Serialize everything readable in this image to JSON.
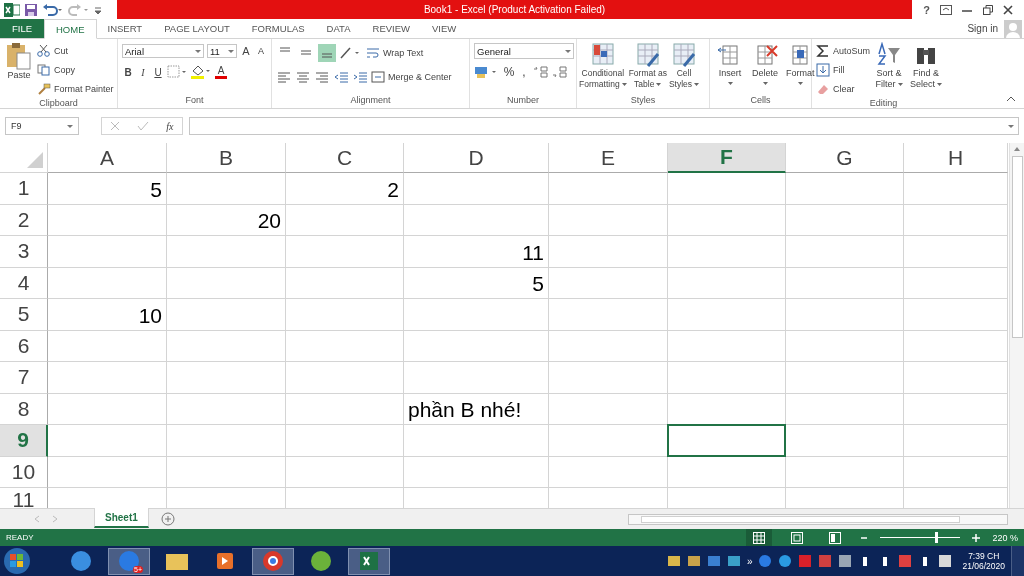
{
  "window": {
    "title": "Book1 -  Excel (Product Activation Failed)",
    "help": "?"
  },
  "tabs": [
    {
      "label": "FILE",
      "kind": "file",
      "selected": false
    },
    {
      "label": "HOME",
      "kind": "tab",
      "selected": true
    },
    {
      "label": "INSERT",
      "kind": "tab",
      "selected": false
    },
    {
      "label": "PAGE LAYOUT",
      "kind": "tab",
      "selected": false
    },
    {
      "label": "FORMULAS",
      "kind": "tab",
      "selected": false
    },
    {
      "label": "DATA",
      "kind": "tab",
      "selected": false
    },
    {
      "label": "REVIEW",
      "kind": "tab",
      "selected": false
    },
    {
      "label": "VIEW",
      "kind": "tab",
      "selected": false
    }
  ],
  "account": {
    "label": "Sign in"
  },
  "ribbon": {
    "groups": [
      {
        "label": "Clipboard",
        "kind": "clipboard",
        "paste": "Paste",
        "items": [
          "Cut",
          "Copy",
          "Format Painter"
        ]
      },
      {
        "label": "Font",
        "kind": "font",
        "font": "Arial",
        "size": "11",
        "size_buttons": [
          "A",
          "A"
        ],
        "styles": [
          "B",
          "I",
          "U"
        ],
        "font_color": "A"
      },
      {
        "label": "Alignment",
        "kind": "alignment",
        "vertical_align": [
          {
            "selected": false
          },
          {
            "selected": false
          },
          {
            "selected": true
          }
        ],
        "items": [
          "Wrap Text",
          "Merge & Center"
        ]
      },
      {
        "label": "Number",
        "kind": "number",
        "format": "General",
        "symbols": [
          "%",
          ","
        ]
      },
      {
        "label": "Styles",
        "kind": "styles",
        "items": [
          {
            "lines": [
              "Conditional",
              "Formatting"
            ]
          },
          {
            "lines": [
              "Format as",
              "Table"
            ]
          },
          {
            "lines": [
              "Cell",
              "Styles"
            ]
          }
        ]
      },
      {
        "label": "Cells",
        "kind": "cells",
        "items": [
          "Insert",
          "Delete",
          "Format"
        ]
      },
      {
        "label": "Editing",
        "kind": "editing",
        "items": [
          "AutoSum",
          "Fill",
          "Clear"
        ],
        "big": [
          {
            "lines": [
              "Sort &",
              "Filter"
            ]
          },
          {
            "lines": [
              "Find &",
              "Select"
            ]
          }
        ]
      }
    ]
  },
  "formula_bar": {
    "name_box": "F9",
    "function": "fx"
  },
  "sheet": {
    "columns": [
      {
        "label": "A",
        "selected": false
      },
      {
        "label": "B",
        "selected": false
      },
      {
        "label": "C",
        "selected": false
      },
      {
        "label": "D",
        "selected": false
      },
      {
        "label": "E",
        "selected": false
      },
      {
        "label": "F",
        "selected": true
      },
      {
        "label": "G",
        "selected": false
      },
      {
        "label": "H",
        "selected": false
      }
    ],
    "rows": [
      {
        "label": "1",
        "selected": false,
        "cells": [
          {
            "text": "5",
            "kind": "number"
          },
          null,
          {
            "text": "2",
            "kind": "number"
          },
          null,
          null,
          null,
          null,
          null
        ]
      },
      {
        "label": "2",
        "selected": false,
        "cells": [
          null,
          {
            "text": "20",
            "kind": "number"
          },
          null,
          null,
          null,
          null,
          null,
          null
        ]
      },
      {
        "label": "3",
        "selected": false,
        "cells": [
          null,
          null,
          null,
          {
            "text": "11",
            "kind": "number"
          },
          null,
          null,
          null,
          null
        ]
      },
      {
        "label": "4",
        "selected": false,
        "cells": [
          null,
          null,
          null,
          {
            "text": "5",
            "kind": "number"
          },
          null,
          null,
          null,
          null
        ]
      },
      {
        "label": "5",
        "selected": false,
        "cells": [
          {
            "text": "10",
            "kind": "number"
          },
          null,
          null,
          null,
          null,
          null,
          null,
          null
        ]
      },
      {
        "label": "6",
        "selected": false,
        "cells": [
          null,
          null,
          null,
          null,
          null,
          null,
          null,
          null
        ]
      },
      {
        "label": "7",
        "selected": false,
        "cells": [
          null,
          null,
          null,
          null,
          null,
          null,
          null,
          null
        ]
      },
      {
        "label": "8",
        "selected": false,
        "cells": [
          null,
          null,
          null,
          {
            "text": "phần B nhé!",
            "kind": "text"
          },
          null,
          null,
          null,
          null
        ]
      },
      {
        "label": "9",
        "selected": true,
        "cells": [
          null,
          null,
          null,
          null,
          null,
          null,
          null,
          null
        ]
      },
      {
        "label": "10",
        "selected": false,
        "cells": [
          null,
          null,
          null,
          null,
          null,
          null,
          null,
          null
        ]
      },
      {
        "label": "11",
        "selected": false,
        "cells": [
          null,
          null,
          null,
          null,
          null,
          null,
          null,
          null
        ]
      }
    ]
  },
  "sheet_tabs": [
    {
      "label": "Sheet1",
      "selected": true
    }
  ],
  "status_bar": {
    "status": "READY",
    "views": [
      {
        "kind": "normal",
        "selected": true
      },
      {
        "kind": "page-layout",
        "selected": false
      },
      {
        "kind": "page-break",
        "selected": false
      }
    ],
    "zoom": {
      "level": 0.7,
      "reading": "220 %"
    }
  },
  "taskbar": {
    "apps": [
      {
        "kind": "ie",
        "selected": false
      },
      {
        "kind": "zalo",
        "selected": true,
        "badge": "5+"
      },
      {
        "kind": "folder",
        "selected": false
      },
      {
        "kind": "media",
        "selected": false
      },
      {
        "kind": "chrome",
        "selected": true
      },
      {
        "kind": "coccoc",
        "selected": false
      },
      {
        "kind": "excel",
        "selected": true
      }
    ],
    "tray": [
      {
        "kind": "folder"
      },
      {
        "kind": "contacts"
      },
      {
        "kind": "computer"
      },
      {
        "kind": "network"
      }
    ],
    "overflow": "»",
    "tray2": [
      {
        "kind": "zalo"
      },
      {
        "kind": "link"
      },
      {
        "kind": "red"
      },
      {
        "kind": "v"
      },
      {
        "kind": "usb"
      },
      {
        "kind": "speaker"
      },
      {
        "kind": "signal"
      },
      {
        "kind": "flag"
      },
      {
        "kind": "battery"
      },
      {
        "kind": "close"
      }
    ],
    "time": "7:39 CH",
    "date": "21/06/2020"
  }
}
